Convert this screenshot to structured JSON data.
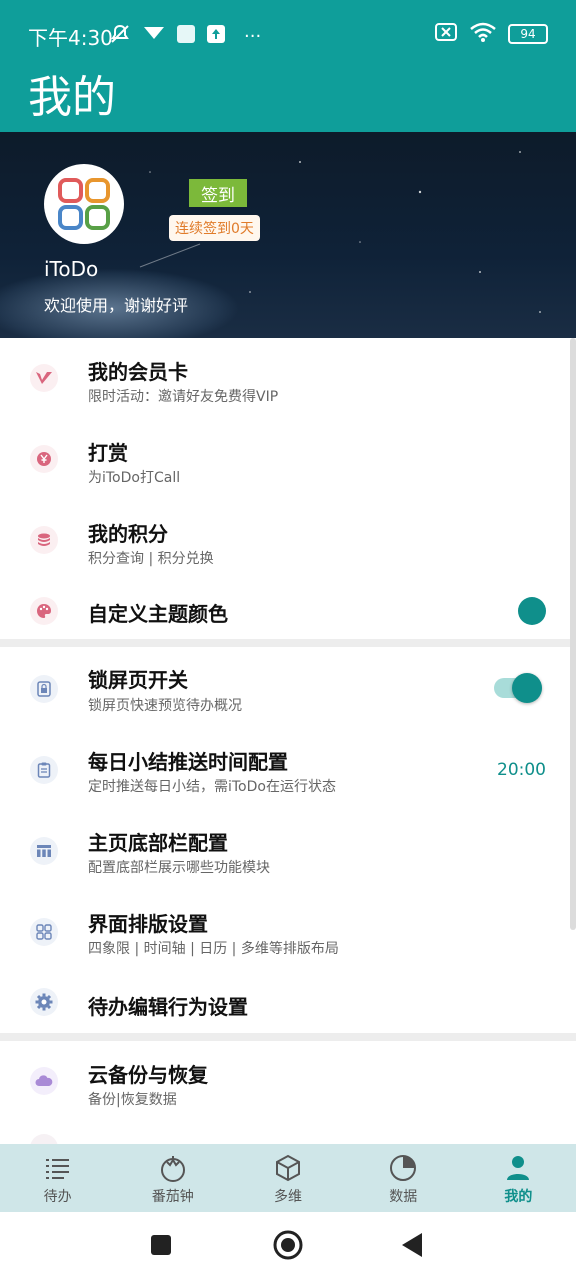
{
  "status_bar": {
    "time": "下午4:30",
    "more": "···",
    "battery": "94"
  },
  "header": {
    "title": "我的"
  },
  "profile": {
    "app_name": "iToDo",
    "welcome": "欢迎使用，谢谢好评",
    "signin_label": "签到",
    "streak_label": "连续签到0天"
  },
  "items": [
    {
      "title": "我的会员卡",
      "subtitle": "限时活动：邀请好友免费得VIP",
      "icon": "vip-icon"
    },
    {
      "title": "打赏",
      "subtitle": "为iToDo打Call",
      "icon": "yen-icon"
    },
    {
      "title": "我的积分",
      "subtitle": "积分查询 | 积分兑换",
      "icon": "coins-icon"
    },
    {
      "title": "自定义主题颜色",
      "icon": "palette-icon"
    },
    {
      "title": "锁屏页开关",
      "subtitle": "锁屏页快速预览待办概况",
      "icon": "lock-icon",
      "toggle_on": true
    },
    {
      "title": "每日小结推送时间配置",
      "subtitle": "定时推送每日小结，需iToDo在运行状态",
      "icon": "clipboard-icon",
      "value": "20:00"
    },
    {
      "title": "主页底部栏配置",
      "subtitle": "配置底部栏展示哪些功能模块",
      "icon": "table-icon"
    },
    {
      "title": "界面排版设置",
      "subtitle": "四象限 | 时间轴 | 日历 | 多维等排版布局",
      "icon": "grid-icon"
    },
    {
      "title": "待办编辑行为设置",
      "icon": "gear-icon"
    },
    {
      "title": "云备份与恢复",
      "subtitle": "备份|恢复数据",
      "icon": "cloud-icon"
    }
  ],
  "colors": {
    "primary": "#0f9e9a",
    "accent": "#0f8f8b",
    "signin": "#7cb93a",
    "streak_text": "#e07b2a"
  },
  "tabs": [
    {
      "label": "待办",
      "icon": "list-icon"
    },
    {
      "label": "番茄钟",
      "icon": "tomato-icon"
    },
    {
      "label": "多维",
      "icon": "cube-icon"
    },
    {
      "label": "数据",
      "icon": "pie-icon"
    },
    {
      "label": "我的",
      "icon": "person-icon",
      "active": true
    }
  ]
}
